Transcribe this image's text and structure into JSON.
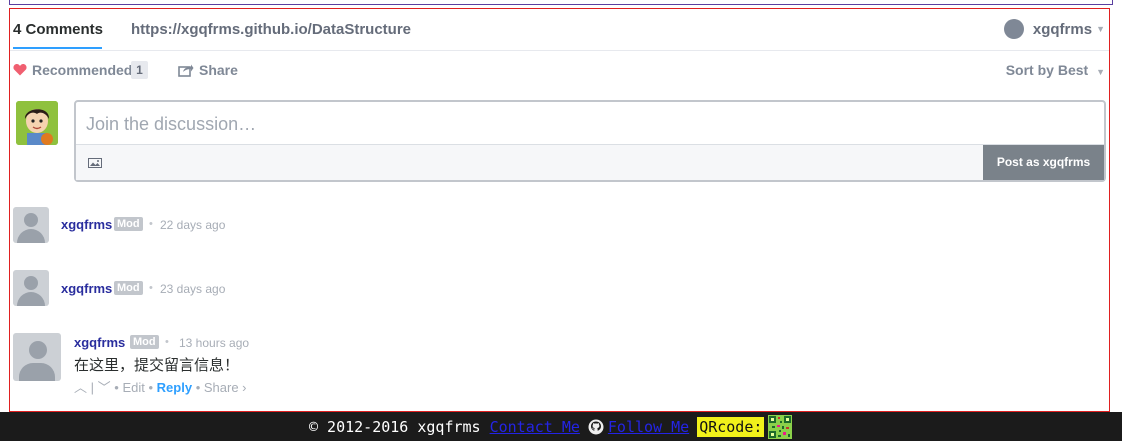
{
  "nav": {
    "comment_count_tab": "4 Comments",
    "site_tab": "https://xgqfrms.github.io/DataStructure",
    "user_name": "xgqfrms"
  },
  "toolbar": {
    "recommended_label": "Recommended",
    "recommended_count": "1",
    "share_label": "Share",
    "sort_label": "Sort by Best"
  },
  "composer": {
    "placeholder": "Join the discussion…",
    "post_button": "Post as xgqfrms"
  },
  "comments": [
    {
      "author": "xgqfrms",
      "badge": "Mod",
      "time": "22 days ago",
      "text": ""
    },
    {
      "author": "xgqfrms",
      "badge": "Mod",
      "time": "23 days ago",
      "text": ""
    },
    {
      "author": "xgqfrms",
      "badge": "Mod",
      "time": "13 hours ago",
      "text": "在这里，提交留言信息！",
      "actions": {
        "edit": "Edit",
        "reply": "Reply",
        "share": "Share ›"
      }
    }
  ],
  "footer": {
    "copyright": "© 2012-2016 xgqfrms",
    "contact_link": "Contact Me",
    "follow_link": "Follow Me",
    "qr_label": "QRcode:"
  },
  "colors": {
    "accent": "#2e9fff",
    "author_link": "#2a2e9e",
    "post_button": "#7a828a",
    "heart": "#f05f70",
    "footer_bg": "#1b1b1b",
    "qr_highlight": "#f1f11a"
  },
  "icons": [
    "heart-icon",
    "share-icon",
    "image-icon",
    "github-icon",
    "qr-code-image",
    "caret-down-icon"
  ]
}
